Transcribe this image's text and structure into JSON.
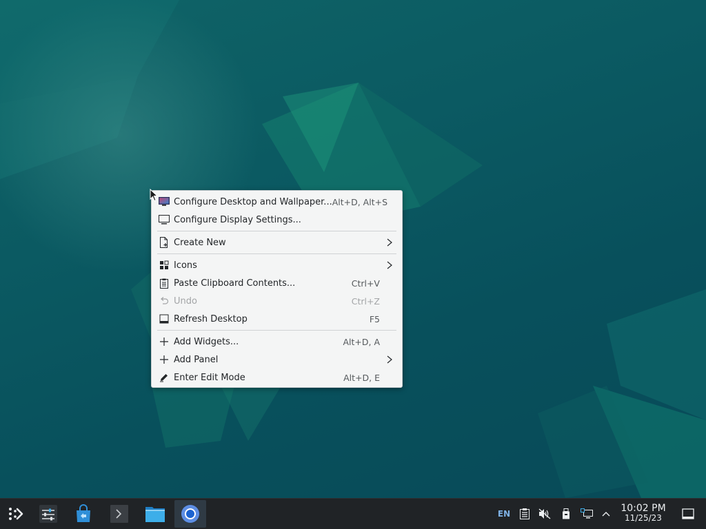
{
  "context_menu": {
    "items": [
      {
        "label": "Configure Desktop and Wallpaper...",
        "shortcut": "Alt+D, Alt+S",
        "icon": "wallpaper-icon"
      },
      {
        "label": "Configure Display Settings...",
        "shortcut": "",
        "icon": "display-icon"
      },
      {
        "label": "Create New",
        "shortcut": "",
        "icon": "new-file-icon",
        "submenu": true
      },
      {
        "label": "Icons",
        "shortcut": "",
        "icon": "icons-grid-icon",
        "submenu": true
      },
      {
        "label": "Paste Clipboard Contents...",
        "shortcut": "Ctrl+V",
        "icon": "clipboard-icon"
      },
      {
        "label": "Undo",
        "shortcut": "Ctrl+Z",
        "icon": "undo-icon",
        "disabled": true
      },
      {
        "label": "Refresh Desktop",
        "shortcut": "F5",
        "icon": "refresh-icon"
      },
      {
        "label": "Add Widgets...",
        "shortcut": "Alt+D, A",
        "icon": "plus-icon"
      },
      {
        "label": "Add Panel",
        "shortcut": "",
        "icon": "plus-icon",
        "submenu": true
      },
      {
        "label": "Enter Edit Mode",
        "shortcut": "Alt+D, E",
        "icon": "edit-icon"
      }
    ]
  },
  "taskbar": {
    "apps": [
      {
        "name": "app-launcher",
        "icon": "kde-launcher-icon"
      },
      {
        "name": "system-settings",
        "icon": "settings-sliders-icon"
      },
      {
        "name": "discover-store",
        "icon": "store-bag-icon"
      },
      {
        "name": "terminal",
        "icon": "terminal-icon"
      },
      {
        "name": "file-manager",
        "icon": "folder-icon"
      },
      {
        "name": "chromium",
        "icon": "chromium-icon"
      }
    ],
    "tray": {
      "language": "EN",
      "icons": [
        "clipboard-tray-icon",
        "volume-muted-icon",
        "removable-device-icon",
        "network-icon",
        "expand-tray-icon"
      ],
      "clock_time": "10:02 PM",
      "clock_date": "11/25/23",
      "show_desktop_icon": "show-desktop-icon"
    }
  },
  "colors": {
    "desktop_base": "#0b5a62",
    "menu_bg": "#f4f5f5",
    "taskbar_bg": "#202326",
    "accent": "#3daee9"
  }
}
